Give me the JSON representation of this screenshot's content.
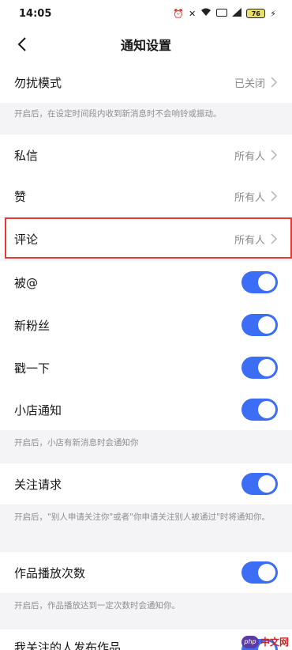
{
  "status_bar": {
    "time": "14:05",
    "battery": "76"
  },
  "header": {
    "title": "通知设置"
  },
  "rows": {
    "dnd": {
      "label": "勿扰模式",
      "value": "已关闭"
    },
    "dnd_note": "开启后，在设定时间段内收到新消息时不会响铃或振动。",
    "dm": {
      "label": "私信",
      "value": "所有人"
    },
    "like": {
      "label": "赞",
      "value": "所有人"
    },
    "comment": {
      "label": "评论",
      "value": "所有人"
    },
    "mention": {
      "label": "被@",
      "enabled": true
    },
    "new_fans": {
      "label": "新粉丝",
      "enabled": true
    },
    "poke": {
      "label": "戳一下",
      "enabled": true
    },
    "shop": {
      "label": "小店通知",
      "enabled": true
    },
    "shop_note": "开启后，小店有新消息时会通知你",
    "follow_req": {
      "label": "关注请求",
      "enabled": true
    },
    "follow_req_note": "开启后，\"别人申请关注你\"或者\"你申请关注别人被通过\"时将通知你。",
    "play_count": {
      "label": "作品播放次数",
      "enabled": true
    },
    "play_count_note": "开启后，作品播放达到一定次数时会通知你。",
    "followed_posts": {
      "label": "我关注的人发布作品",
      "enabled": true
    }
  },
  "watermark": {
    "badge": "php",
    "text": "中文网"
  },
  "colors": {
    "accent": "#3b6df5",
    "highlight": "#e53935"
  }
}
